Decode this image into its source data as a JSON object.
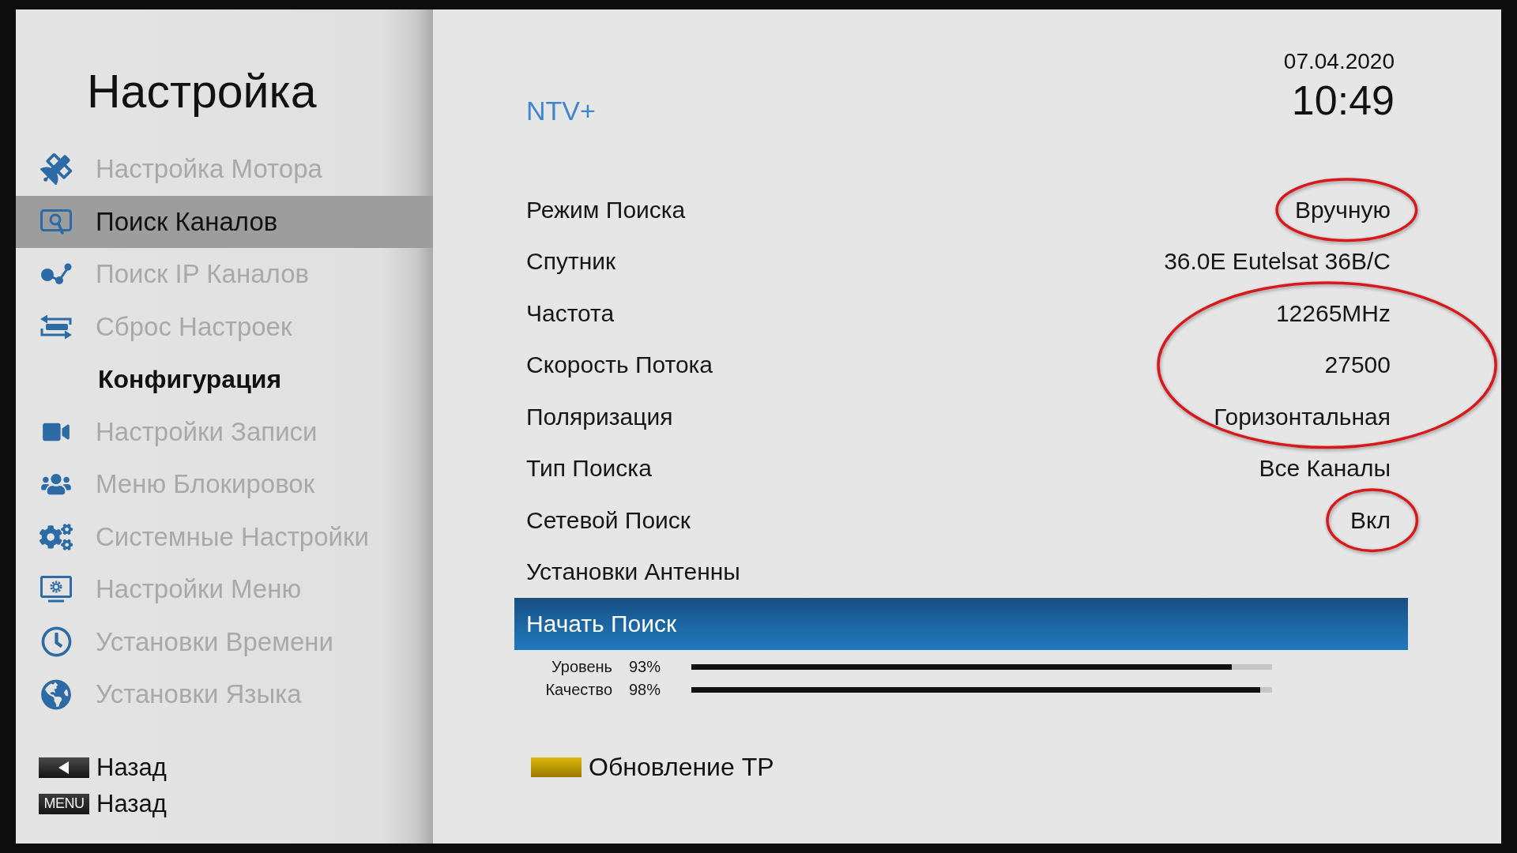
{
  "sidebar": {
    "title": "Настройка",
    "items": [
      {
        "kind": "item",
        "label": "Настройка Мотора",
        "selected": false
      },
      {
        "kind": "item",
        "label": "Поиск Каналов",
        "selected": true
      },
      {
        "kind": "item",
        "label": "Поиск IP Каналов",
        "selected": false
      },
      {
        "kind": "item",
        "label": "Сброс Настроек",
        "selected": false
      },
      {
        "kind": "header",
        "label": "Конфигурация",
        "selected": false
      },
      {
        "kind": "item",
        "label": "Настройки Записи",
        "selected": false
      },
      {
        "kind": "item",
        "label": "Меню Блокировок",
        "selected": false
      },
      {
        "kind": "item",
        "label": "Системные Настройки",
        "selected": false
      },
      {
        "kind": "item",
        "label": "Настройки Меню",
        "selected": false
      },
      {
        "kind": "item",
        "label": "Установки Времени",
        "selected": false
      },
      {
        "kind": "item",
        "label": "Установки Языка",
        "selected": false
      }
    ],
    "hints": [
      {
        "kind": "arrow_key",
        "label": "Назад"
      },
      {
        "kind": "text_key",
        "key": "MENU",
        "label": "Назад"
      }
    ]
  },
  "main": {
    "title": "NTV+",
    "date": "07.04.2020",
    "time": "10:49",
    "rows": [
      {
        "label": "Режим Поиска",
        "value": "Вручную",
        "selected": false,
        "circled": true
      },
      {
        "label": "Спутник",
        "value": "36.0E Eutelsat 36B/C",
        "selected": false,
        "circled": false
      },
      {
        "label": "Частота",
        "value": "12265MHz",
        "selected": false,
        "circled": true
      },
      {
        "label": "Скорость Потока",
        "value": "27500",
        "selected": false,
        "circled": true
      },
      {
        "label": "Поляризация",
        "value": "Горизонтальная",
        "selected": false,
        "circled": true
      },
      {
        "label": "Тип Поиска",
        "value": "Все Каналы",
        "selected": false,
        "circled": false
      },
      {
        "label": "Сетевой Поиск",
        "value": "Вкл",
        "selected": false,
        "circled": true
      },
      {
        "label": "Установки Антенны",
        "selected": false,
        "circled": false
      },
      {
        "label": "Начать Поиск",
        "selected": true,
        "circled": false
      }
    ],
    "meters": [
      {
        "label": "Уровень",
        "reading": "93%",
        "level": 0.93
      },
      {
        "label": "Качество",
        "reading": "98%",
        "level": 0.98
      }
    ],
    "hints": [
      {
        "kind": "color_key",
        "label": "Обновление ТР"
      }
    ]
  }
}
